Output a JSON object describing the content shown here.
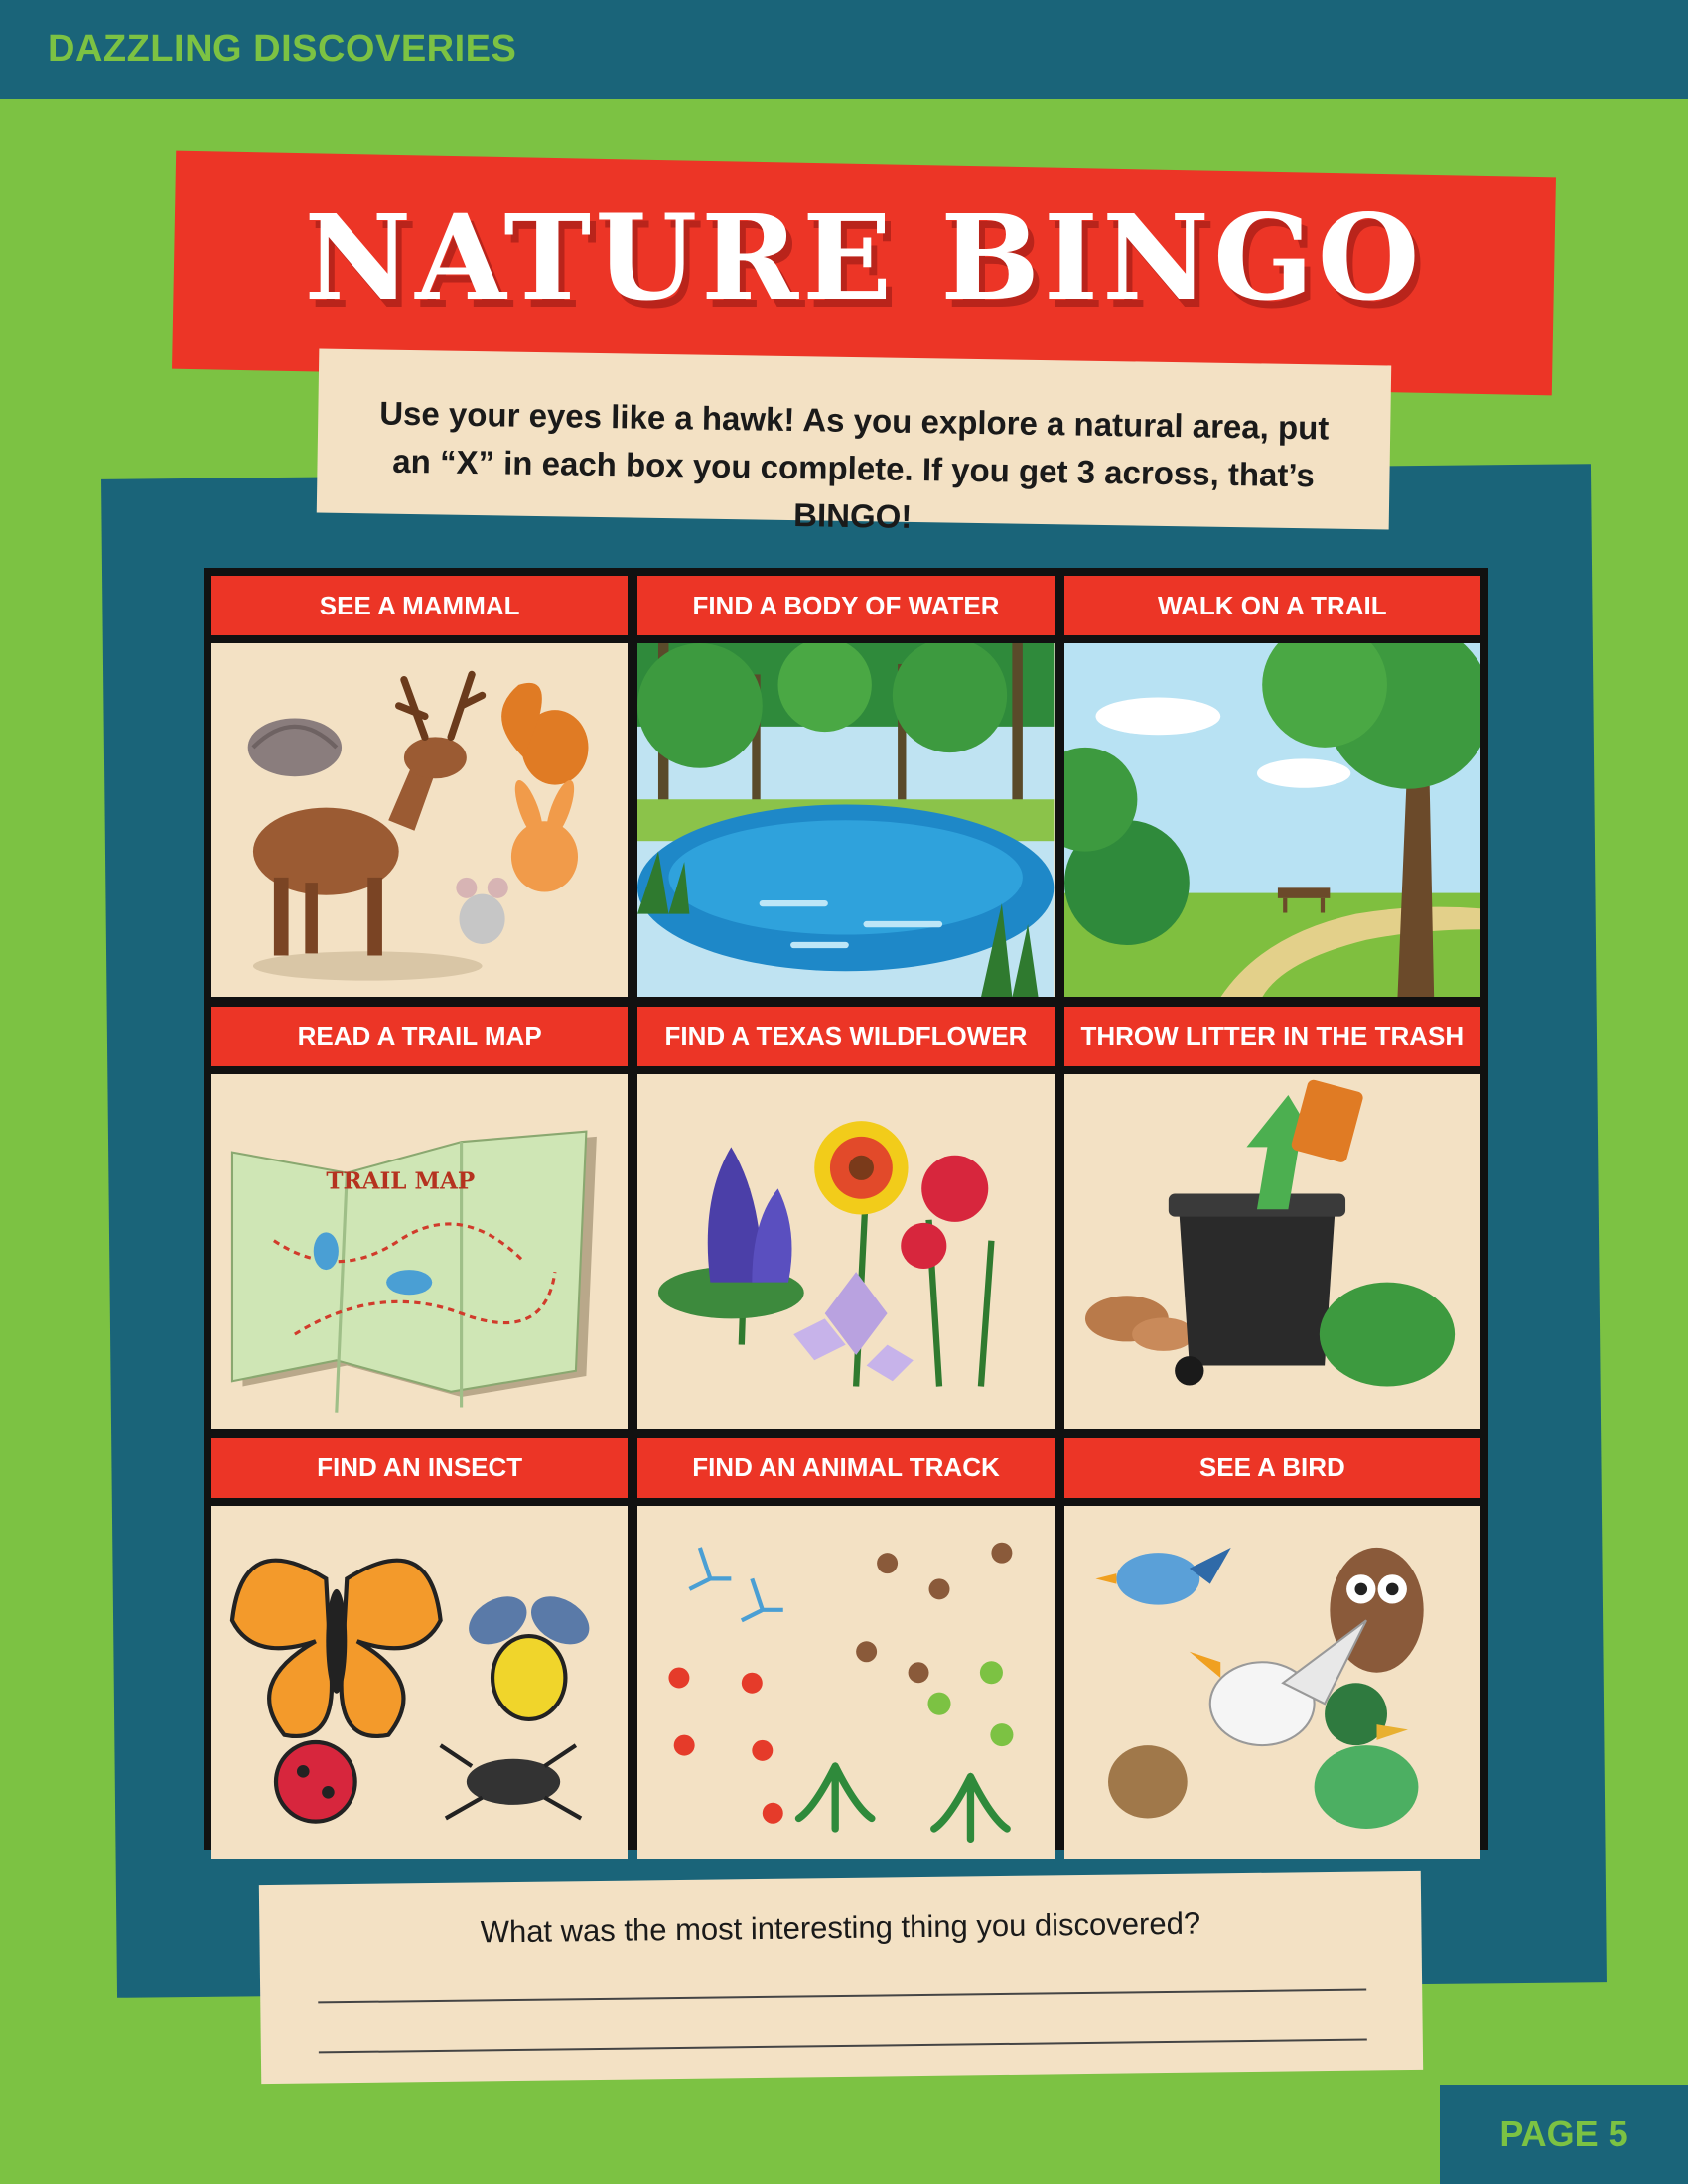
{
  "header": {
    "series": "DAZZLING DISCOVERIES"
  },
  "title": "NATURE BINGO",
  "intro": "Use your eyes like a hawk! As you explore a natural area, put an “X” in each box you complete. If you get 3 across, that’s BINGO!",
  "cells": [
    {
      "label": "SEE A MAMMAL",
      "icon": "mammals-illustration"
    },
    {
      "label": "FIND A BODY OF WATER",
      "icon": "pond-illustration"
    },
    {
      "label": "WALK ON A TRAIL",
      "icon": "trail-illustration"
    },
    {
      "label": "READ A TRAIL MAP",
      "icon": "trail-map-illustration",
      "map_title": "TRAIL MAP"
    },
    {
      "label": "FIND A TEXAS WILDFLOWER",
      "icon": "wildflowers-illustration"
    },
    {
      "label": "THROW LITTER IN THE TRASH",
      "icon": "trash-can-illustration"
    },
    {
      "label": "FIND AN INSECT",
      "icon": "insects-illustration"
    },
    {
      "label": "FIND AN ANIMAL TRACK",
      "icon": "animal-tracks-illustration"
    },
    {
      "label": "SEE A BIRD",
      "icon": "birds-illustration"
    }
  ],
  "question": "What was the most interesting thing you discovered?",
  "footer": {
    "page": "PAGE 5"
  },
  "colors": {
    "green": "#7cc243",
    "teal": "#1a6479",
    "red": "#ec3526",
    "cream": "#f3e1c4"
  }
}
